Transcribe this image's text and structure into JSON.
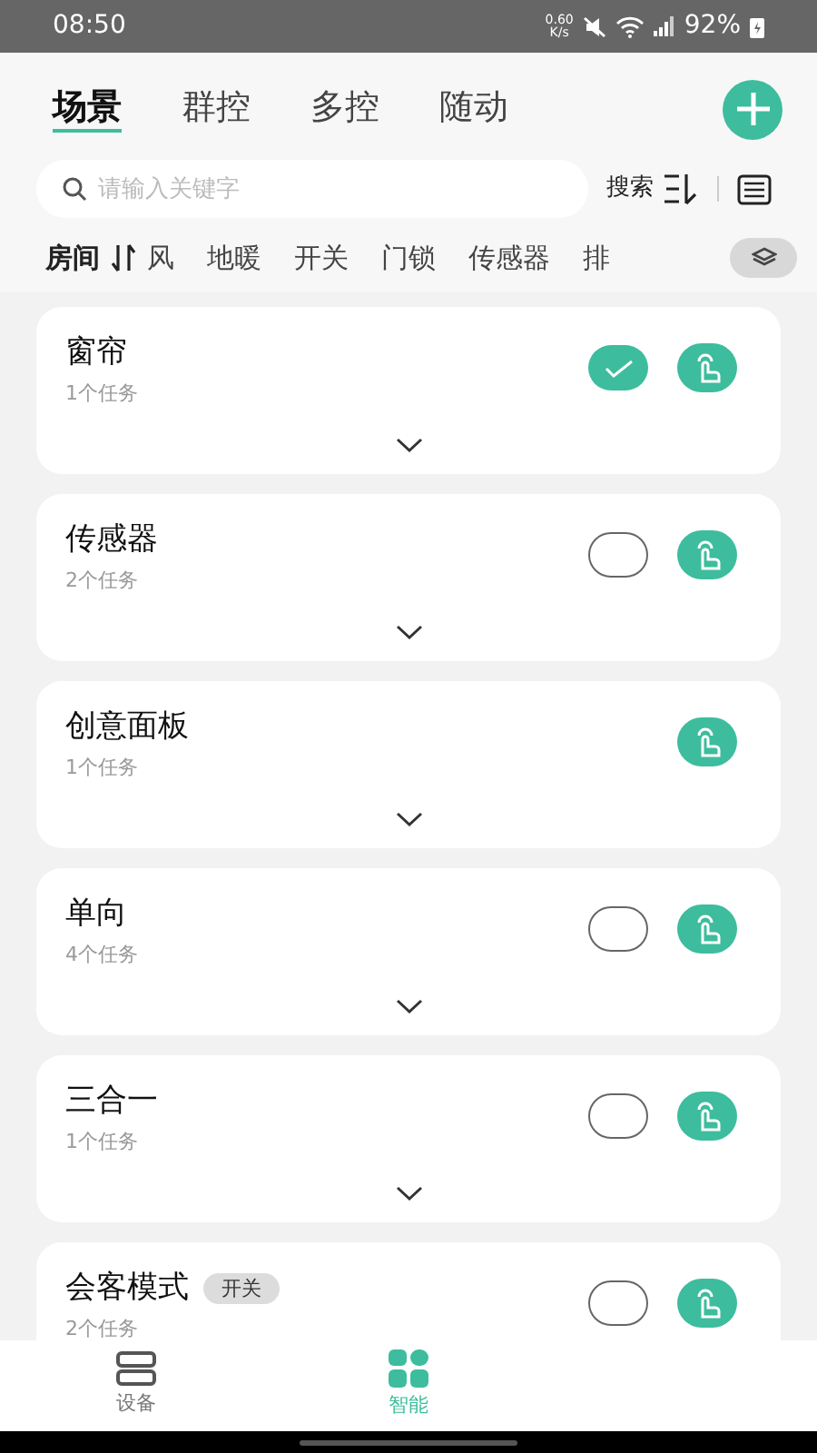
{
  "status_bar": {
    "time": "08:50",
    "net_speed": "0.60",
    "net_unit": "K/s",
    "battery": "92%"
  },
  "tabs": [
    {
      "label": "场景",
      "selected": true
    },
    {
      "label": "群控",
      "selected": false
    },
    {
      "label": "多控",
      "selected": false
    },
    {
      "label": "随动",
      "selected": false
    }
  ],
  "search": {
    "placeholder": "请输入关键字",
    "button": "搜索"
  },
  "filters": [
    {
      "label": "房间",
      "selected": true
    },
    {
      "label": "风",
      "selected": false
    },
    {
      "label": "地暖",
      "selected": false
    },
    {
      "label": "开关",
      "selected": false
    },
    {
      "label": "门锁",
      "selected": false
    },
    {
      "label": "传感器",
      "selected": false
    },
    {
      "label": "排",
      "selected": false
    }
  ],
  "scenes": [
    {
      "name": "窗帘",
      "tasks": "1个任务",
      "kind": "selectable",
      "selected": true
    },
    {
      "name": "传感器",
      "tasks": "2个任务",
      "kind": "selectable",
      "selected": false
    },
    {
      "name": "创意面板",
      "tasks": "1个任务",
      "kind": "plain"
    },
    {
      "name": "单向",
      "tasks": "4个任务",
      "kind": "selectable",
      "selected": false
    },
    {
      "name": "三合一",
      "tasks": "1个任务",
      "kind": "selectable",
      "selected": false
    },
    {
      "name": "会客模式",
      "tag": "开关",
      "tasks": "2个任务",
      "kind": "selectable",
      "selected": false
    }
  ],
  "bottom_nav": [
    {
      "label": "设备",
      "selected": false
    },
    {
      "label": "智能",
      "selected": true
    }
  ]
}
